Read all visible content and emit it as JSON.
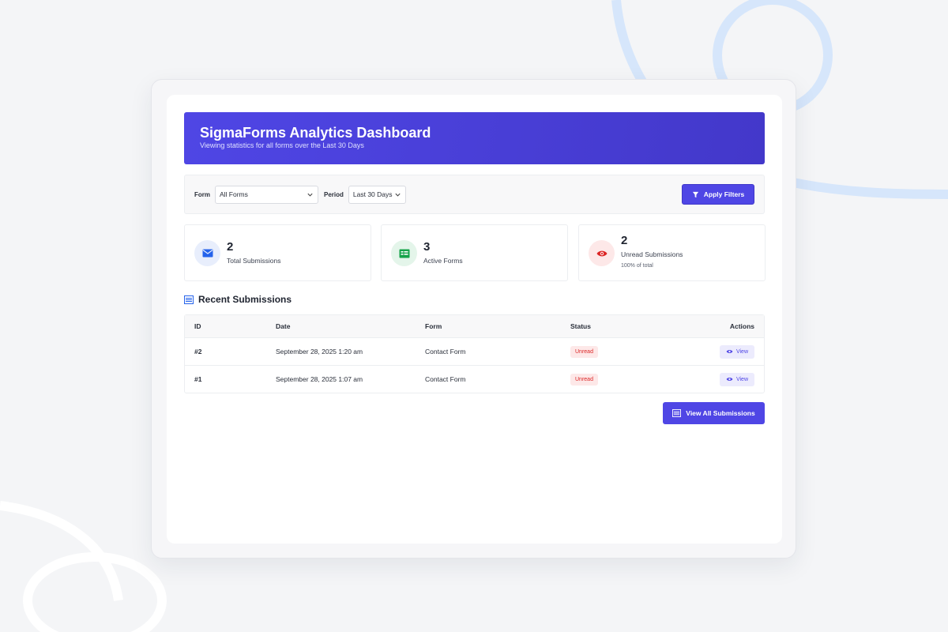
{
  "header": {
    "title": "SigmaForms Analytics Dashboard",
    "subtitle": "Viewing statistics for all forms over the Last 30 Days"
  },
  "filters": {
    "form_label": "Form",
    "form_value": "All Forms",
    "period_label": "Period",
    "period_value": "Last 30 Days",
    "apply_label": "Apply Filters"
  },
  "stats": [
    {
      "value": "2",
      "label": "Total Submissions",
      "icon": "envelope-icon",
      "color": "#2563eb",
      "bg": "#e8eefc"
    },
    {
      "value": "3",
      "label": "Active Forms",
      "icon": "form-icon",
      "color": "#16a34a",
      "bg": "#e4f5ea"
    },
    {
      "value": "2",
      "label": "Unread Submissions",
      "note": "100% of total",
      "icon": "eye-icon",
      "color": "#dc2626",
      "bg": "#fde8e8"
    }
  ],
  "recent": {
    "title": "Recent Submissions",
    "columns": [
      "ID",
      "Date",
      "Form",
      "Status",
      "Actions"
    ],
    "rows": [
      {
        "id": "#2",
        "date": "September 28, 2025 1:20 am",
        "form": "Contact Form",
        "status": "Unread",
        "action": "View"
      },
      {
        "id": "#1",
        "date": "September 28, 2025 1:07 am",
        "form": "Contact Form",
        "status": "Unread",
        "action": "View"
      }
    ],
    "view_all_label": "View All Submissions"
  },
  "colors": {
    "accent": "#4f46e5",
    "unread": "#dc2626"
  }
}
